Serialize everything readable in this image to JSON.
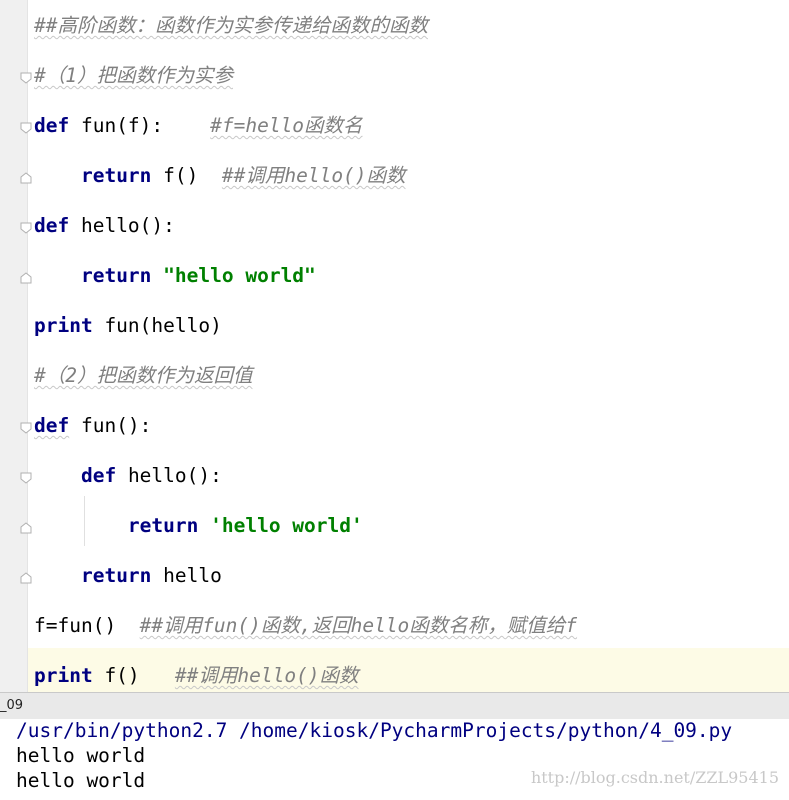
{
  "editor": {
    "lines": [
      {
        "comment": "##高阶函数：函数作为实参传递给函数的函数"
      },
      {
        "comment": "#（1）把函数作为实参"
      },
      {
        "kw": "def",
        "code": " fun(f):    ",
        "comment": "#f=hello函数名"
      },
      {
        "indent": "    ",
        "kw": "return",
        "code": " f()  ",
        "comment": "##调用hello()函数"
      },
      {
        "kw": "def",
        "code": " hello():"
      },
      {
        "indent": "    ",
        "kw": "return",
        "code": " ",
        "string": "\"hello world\""
      },
      {
        "kw": "print",
        "code": " fun(hello)"
      },
      {
        "comment": "#（2）把函数作为返回值"
      },
      {
        "kw": "def",
        "code": " fun():"
      },
      {
        "indent": "    ",
        "kw": "def",
        "code": " hello():"
      },
      {
        "indent": "        ",
        "kw": "return",
        "code": " ",
        "string": "'hello world'"
      },
      {
        "indent": "    ",
        "kw": "return",
        "code": " hello"
      },
      {
        "code": "f=fun()  ",
        "comment": "##调用fun()函数,返回hello函数名称，赋值给f"
      },
      {
        "kw": "print",
        "code": " f()   ",
        "comment": "##调用hello()函数"
      }
    ]
  },
  "run_panel": {
    "tab_label": "_09"
  },
  "console": {
    "command": "/usr/bin/python2.7 /home/kiosk/PycharmProjects/python/4_09.py",
    "output": [
      "hello world",
      "hello world"
    ]
  },
  "watermark": "http://blog.csdn.net/ZZL95415"
}
